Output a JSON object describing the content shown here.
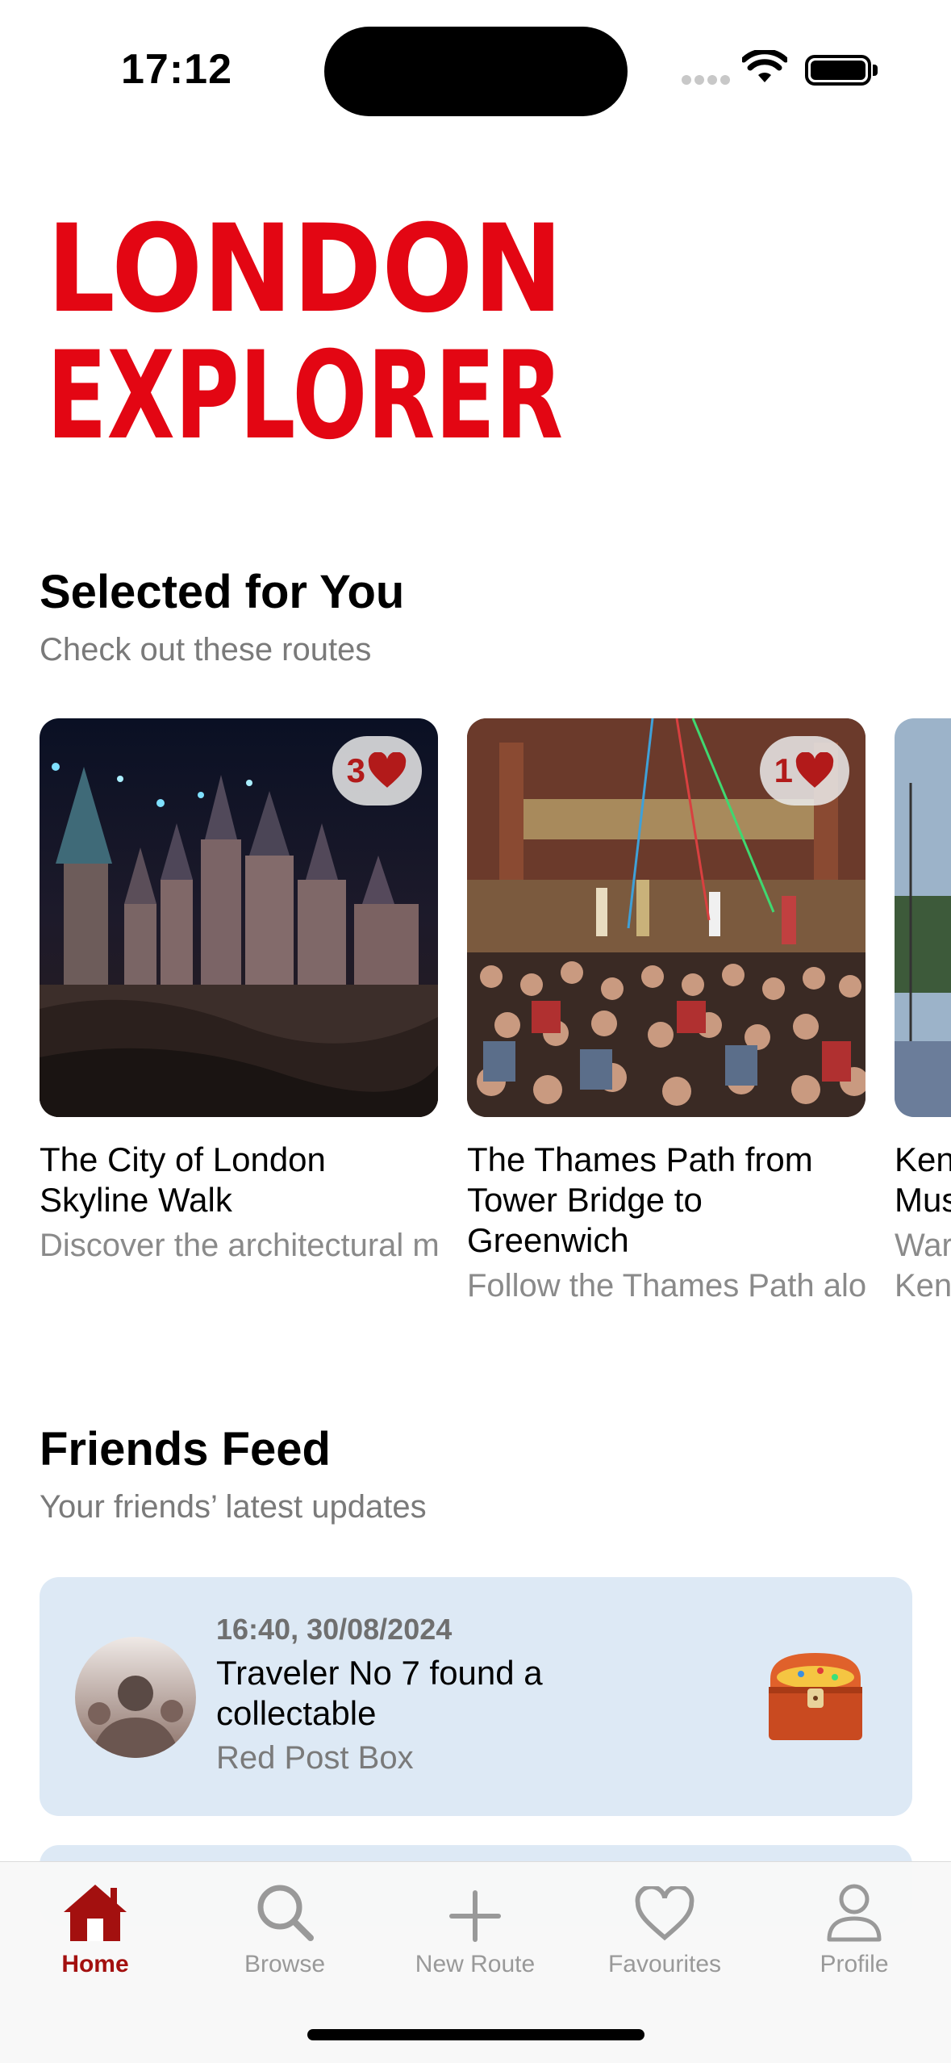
{
  "status_bar": {
    "time": "17:12"
  },
  "logo": {
    "line1": "LONDON",
    "line2": "EXPLORER",
    "color": "#e30613"
  },
  "selected": {
    "title": "Selected for You",
    "subtitle": "Check out these routes",
    "routes": [
      {
        "likes": "3",
        "title": "The City of London Skyline Walk",
        "desc": "Discover the architectural marvels of…"
      },
      {
        "likes": "1",
        "title": "The Thames Path from Tower Bridge to Greenwich",
        "desc": "Follow the Thames Path along one of London's…"
      },
      {
        "title": "Ken\nMus",
        "desc": "War\nKen"
      }
    ]
  },
  "feed": {
    "title": "Friends Feed",
    "subtitle": "Your friends’ latest updates",
    "items": [
      {
        "time": "16:40, 30/08/2024",
        "title": "Traveler No 7 found a collectable",
        "subtitle": "Red Post Box"
      }
    ]
  },
  "tabbar": {
    "accent": "#a3100f",
    "tabs": [
      {
        "label": "Home",
        "icon": "home-icon",
        "active": true
      },
      {
        "label": "Browse",
        "icon": "search-icon"
      },
      {
        "label": "New Route",
        "icon": "plus-icon"
      },
      {
        "label": "Favourites",
        "icon": "heart-icon"
      },
      {
        "label": "Profile",
        "icon": "person-icon"
      }
    ]
  }
}
